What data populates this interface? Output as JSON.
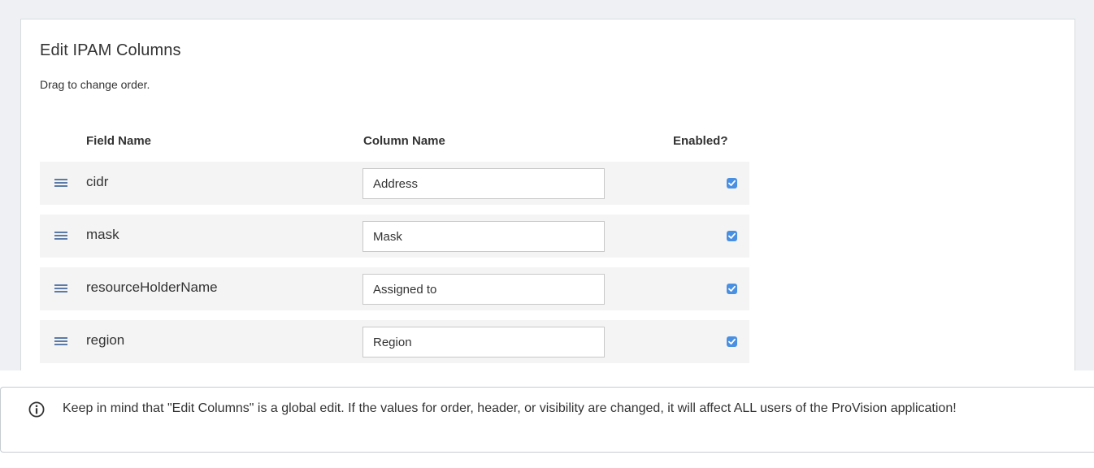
{
  "panel": {
    "title": "Edit IPAM Columns",
    "subtitle": "Drag to change order."
  },
  "table": {
    "headers": {
      "field": "Field Name",
      "column": "Column Name",
      "enabled": "Enabled?"
    },
    "rows": [
      {
        "field": "cidr",
        "column": "Address",
        "enabled": true
      },
      {
        "field": "mask",
        "column": "Mask",
        "enabled": true
      },
      {
        "field": "resourceHolderName",
        "column": "Assigned to",
        "enabled": true
      },
      {
        "field": "region",
        "column": "Region",
        "enabled": true
      }
    ]
  },
  "note": {
    "icon": "info-icon",
    "text": "Keep in mind that \"Edit Columns\" is a global edit. If the values for order, header, or visibility are changed, it will affect ALL users of the ProVision application!"
  },
  "colors": {
    "accent": "#4a90e2",
    "handle": "#5b7aa8"
  }
}
